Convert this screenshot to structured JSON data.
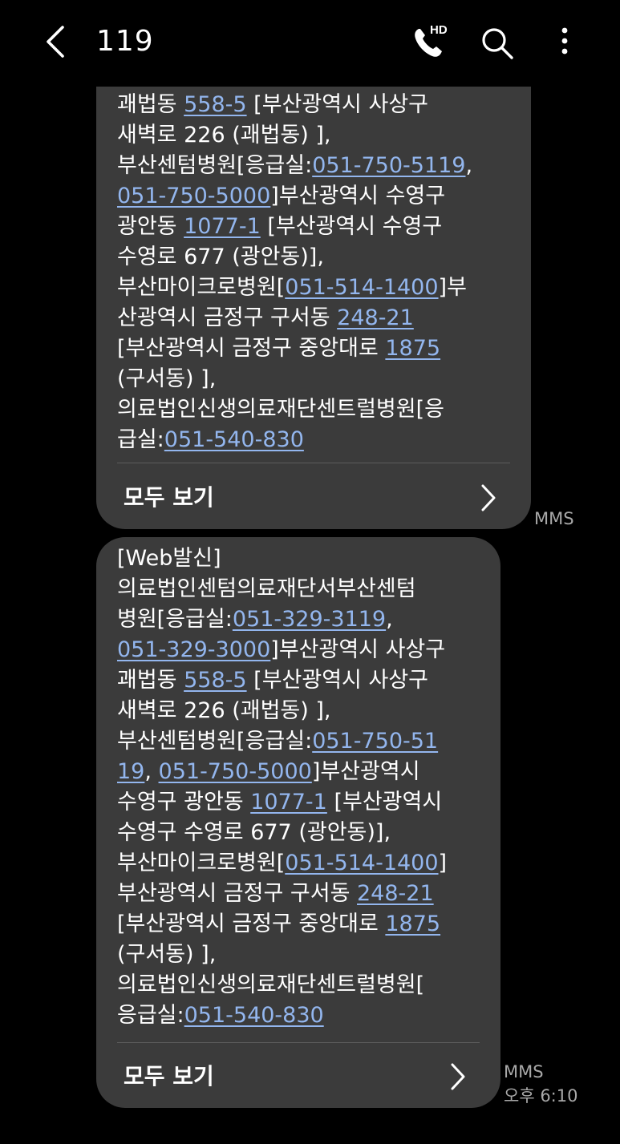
{
  "header": {
    "title": "119",
    "hd_badge": "HD",
    "icons": {
      "back": "chevron-left-icon",
      "call": "hd-voice-call-icon",
      "search": "search-icon",
      "more": "more-vertical-icon"
    }
  },
  "colors": {
    "background": "#000000",
    "bubble": "#3b3b3b",
    "link": "#93b6ee",
    "meta": "#a8a8a8"
  },
  "messages": [
    {
      "lines": [
        [
          {
            "t": "괘법동 "
          },
          {
            "t": "558-5",
            "link": true
          },
          {
            "t": "  [부산광역시 사상구"
          }
        ],
        [
          {
            "t": "새벽로 226 (괘법동) ],"
          }
        ],
        [
          {
            "t": "부산센텀병원[응급실:"
          },
          {
            "t": "051-750-5119",
            "link": true
          },
          {
            "t": ","
          }
        ],
        [
          {
            "t": "051-750-5000",
            "link": true
          },
          {
            "t": "]부산광역시 수영구"
          }
        ],
        [
          {
            "t": "광안동 "
          },
          {
            "t": "1077-1",
            "link": true
          },
          {
            "t": " [부산광역시 수영구"
          }
        ],
        [
          {
            "t": "수영로 677 (광안동)],"
          }
        ],
        [
          {
            "t": "부산마이크로병원["
          },
          {
            "t": "051-514-1400",
            "link": true
          },
          {
            "t": "]부"
          }
        ],
        [
          {
            "t": "산광역시 금정구 구서동 "
          },
          {
            "t": "248-21",
            "link": true
          }
        ],
        [
          {
            "t": "[부산광역시 금정구 중앙대로 "
          },
          {
            "t": "1875",
            "link": true
          }
        ],
        [
          {
            "t": "(구서동) ],"
          }
        ],
        [
          {
            "t": "의료법인신생의료재단센트럴병원[응"
          }
        ],
        [
          {
            "t": "급실:"
          },
          {
            "t": "051-540-830",
            "link": true
          }
        ]
      ],
      "view_all_label": "모두 보기",
      "type_label": "MMS",
      "time": ""
    },
    {
      "lines": [
        [
          {
            "t": "[Web발신]"
          }
        ],
        [
          {
            "t": "의료법인센텀의료재단서부산센텀"
          }
        ],
        [
          {
            "t": "병원[응급실:"
          },
          {
            "t": "051-329-3119",
            "link": true
          },
          {
            "t": ","
          }
        ],
        [
          {
            "t": "051-329-3000",
            "link": true
          },
          {
            "t": "]부산광역시 사상구"
          }
        ],
        [
          {
            "t": "괘법동 "
          },
          {
            "t": "558-5",
            "link": true
          },
          {
            "t": "  [부산광역시 사상구"
          }
        ],
        [
          {
            "t": "새벽로 226 (괘법동) ],"
          }
        ],
        [
          {
            "t": "부산센텀병원[응급실:"
          },
          {
            "t": "051-750-51",
            "link": true
          }
        ],
        [
          {
            "t": "19",
            "link": true
          },
          {
            "t": ", "
          },
          {
            "t": "051-750-5000",
            "link": true
          },
          {
            "t": "]부산광역시"
          }
        ],
        [
          {
            "t": "수영구 광안동 "
          },
          {
            "t": "1077-1",
            "link": true
          },
          {
            "t": " [부산광역시"
          }
        ],
        [
          {
            "t": "수영구 수영로 677 (광안동)],"
          }
        ],
        [
          {
            "t": "부산마이크로병원["
          },
          {
            "t": "051-514-1400",
            "link": true
          },
          {
            "t": "]"
          }
        ],
        [
          {
            "t": "부산광역시 금정구 구서동 "
          },
          {
            "t": "248-21",
            "link": true
          }
        ],
        [
          {
            "t": "[부산광역시 금정구 중앙대로 "
          },
          {
            "t": "1875",
            "link": true
          }
        ],
        [
          {
            "t": "(구서동) ],"
          }
        ],
        [
          {
            "t": "의료법인신생의료재단센트럴병원["
          }
        ],
        [
          {
            "t": "응급실:"
          },
          {
            "t": "051-540-830",
            "link": true
          }
        ]
      ],
      "view_all_label": "모두 보기",
      "type_label": "MMS",
      "time": "오후 6:10"
    }
  ]
}
